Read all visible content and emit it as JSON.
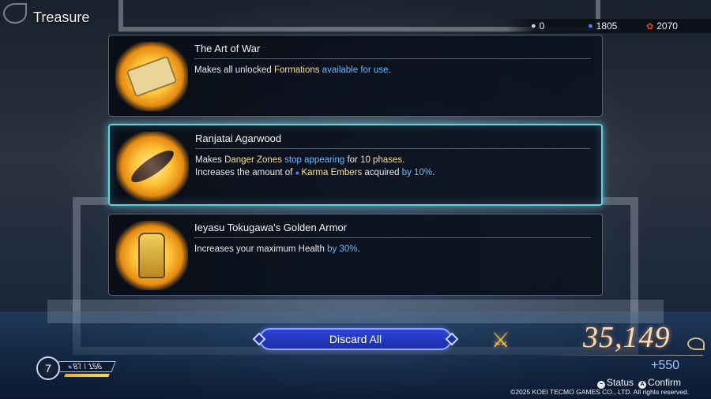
{
  "screen": {
    "title": "Treasure"
  },
  "currencies": [
    {
      "icon": "gem-icon",
      "value": "0"
    },
    {
      "icon": "karma-ember-icon",
      "value": "1805"
    },
    {
      "icon": "red-seal-icon",
      "value": "2070"
    }
  ],
  "cards": [
    {
      "title": "The Art of War",
      "icon": "scroll-icon",
      "desc": [
        [
          {
            "t": "Makes all unlocked ",
            "c": "plain"
          },
          {
            "t": "Formations",
            "c": "yellow"
          },
          {
            "t": " available for use",
            "c": "blue"
          },
          {
            "t": ".",
            "c": "plain"
          }
        ]
      ]
    },
    {
      "title": "Ranjatai Agarwood",
      "icon": "agarwood-icon",
      "selected": true,
      "desc": [
        [
          {
            "t": "Makes ",
            "c": "plain"
          },
          {
            "t": "Danger Zones",
            "c": "yellow"
          },
          {
            "t": " stop appearing",
            "c": "blue"
          },
          {
            "t": " for ",
            "c": "plain"
          },
          {
            "t": "10 phases",
            "c": "yellow"
          },
          {
            "t": ".",
            "c": "plain"
          }
        ],
        [
          {
            "t": "Increases the amount of ",
            "c": "plain"
          },
          {
            "t": "Karma Embers",
            "c": "yellow-ember"
          },
          {
            "t": " acquired ",
            "c": "plain"
          },
          {
            "t": "by 10%",
            "c": "blue"
          },
          {
            "t": ".",
            "c": "plain"
          }
        ]
      ]
    },
    {
      "title": "Ieyasu Tokugawa's Golden Armor",
      "icon": "golden-armor-icon",
      "desc": [
        [
          {
            "t": "Increases your maximum Health ",
            "c": "plain"
          },
          {
            "t": "by 30%",
            "c": "blue"
          },
          {
            "t": ".",
            "c": "plain"
          }
        ]
      ]
    }
  ],
  "discard_button": {
    "label": "Discard All"
  },
  "score": {
    "value": "35,149",
    "bonus": "+550"
  },
  "player": {
    "level": "7",
    "hp": "87 / 156",
    "hp_fraction": 0.56
  },
  "hints": {
    "status": "Status",
    "confirm": "Confirm",
    "status_glyph": "−",
    "confirm_glyph": "A"
  },
  "copyright": "©2025 KOEI TECMO GAMES CO., LTD. All rights reserved.",
  "colors": {
    "accent_cyan": "#5fd2de",
    "button_blue": "#1c2ea8",
    "highlight_yellow": "#f4e08a",
    "highlight_blue": "#6ab8ff"
  }
}
